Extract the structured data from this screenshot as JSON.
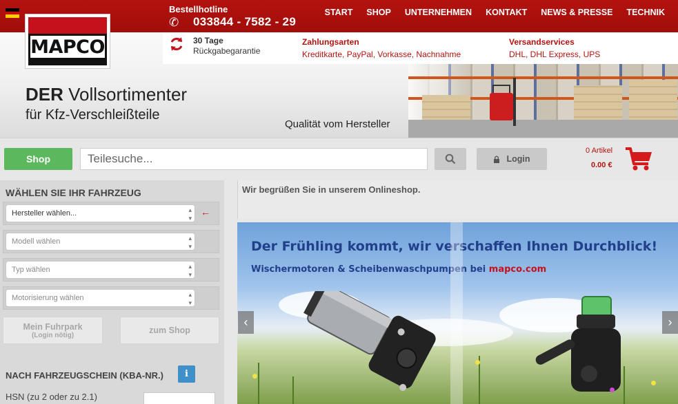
{
  "header": {
    "hotline_label": "Bestellhotline",
    "hotline_number": "033844 - 7582 - 29",
    "logo_text": "MAPCO",
    "nav": [
      "START",
      "SHOP",
      "UNTERNEHMEN",
      "KONTAKT",
      "NEWS & PRESSE",
      "TECHNIK"
    ],
    "return_days": "30 Tage",
    "return_text": "Rückgabegarantie",
    "payment_title": "Zahlungsarten",
    "payment_text": "Kreditkarte, PayPal, Vorkasse, Nachnahme",
    "shipping_title": "Versandservices",
    "shipping_text": "DHL, DHL Express, UPS",
    "hero_title_bold": "DER",
    "hero_title_rest": " Vollsortimenter",
    "hero_subtitle": "für Kfz-Verschleißteile",
    "hero_tagline": "Qualität vom Hersteller"
  },
  "searchbar": {
    "shop_label": "Shop",
    "search_placeholder": "Teilesuche...",
    "login_label": "Login",
    "cart_count": "0 Artikel",
    "cart_total": "0.00 €"
  },
  "sidebar": {
    "vehicle_heading": "WÄHLEN SIE IHR FAHRZEUG",
    "manufacturer": "Hersteller wählen...",
    "model": "Modell wählen",
    "type": "Typ wählen",
    "engine": "Motorisierung wählen",
    "fleet_label": "Mein Fuhrpark",
    "fleet_note": "(Login nötig)",
    "to_shop_label": "zum Shop",
    "kba_heading": "NACH FAHRZEUGSCHEIN (KBA-NR.)",
    "info_label": "i",
    "hsn_label": "HSN (zu 2 oder zu 2.1)"
  },
  "main": {
    "welcome": "Wir begrüßen Sie in unserem Onlineshop.",
    "slide_headline": "Der Frühling kommt, wir verschaffen Ihnen Durchblick!",
    "slide_sub": "Wischermotoren & Scheibenwaschpumpen bei ",
    "slide_brand": "mapco.com"
  },
  "colors": {
    "brand_red": "#b3130f",
    "shop_green": "#5cb85c",
    "info_blue": "#3f8fc9"
  }
}
